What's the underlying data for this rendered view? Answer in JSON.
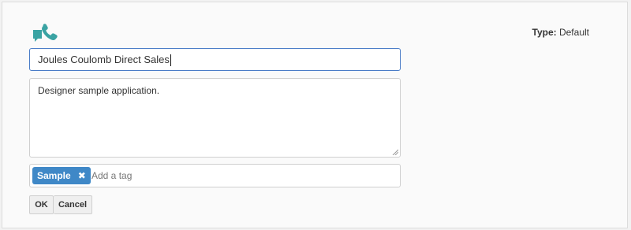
{
  "app": {
    "icon": "phone-chat-icon",
    "icon_color": "#3aa3a3",
    "type_label": "Type:",
    "type_value": "Default"
  },
  "form": {
    "name_value": "Joules Coulomb Direct Sales",
    "description_value": "Designer sample application.",
    "tags": [
      {
        "label": "Sample",
        "remove_symbol": "✖"
      }
    ],
    "tag_placeholder": "Add a tag",
    "tag_color": "#3f88c7",
    "focus_border_color": "#4a7cc7"
  },
  "actions": {
    "ok_label": "OK",
    "cancel_label": "Cancel"
  }
}
